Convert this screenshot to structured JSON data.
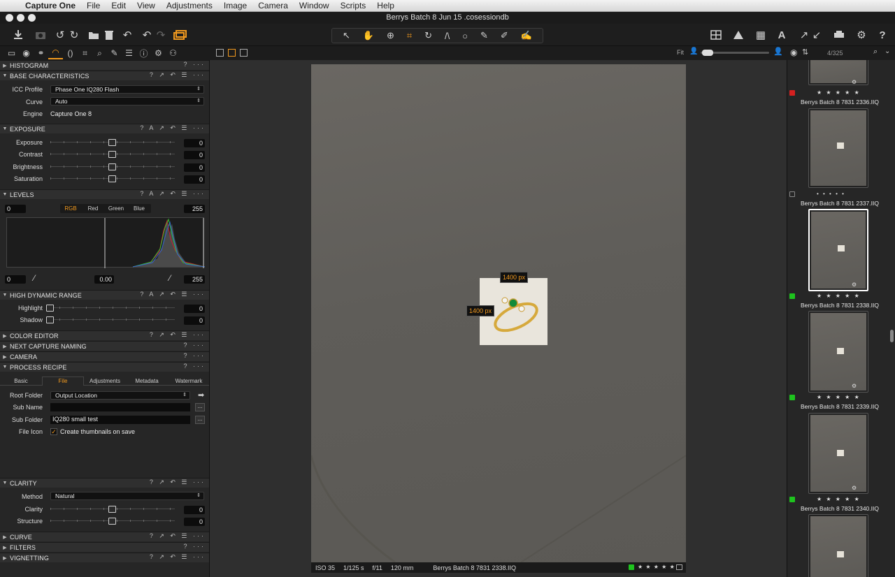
{
  "menubar": {
    "app_name": "Capture One",
    "items": [
      "File",
      "Edit",
      "View",
      "Adjustments",
      "Image",
      "Camera",
      "Window",
      "Scripts",
      "Help"
    ]
  },
  "window": {
    "title": "Berrys Batch 8 Jun 15 .cosessiondb"
  },
  "viewer": {
    "zoom_label": "Fit",
    "dimension_width": "1400 px",
    "dimension_height": "1400 px",
    "status": {
      "iso": "ISO 35",
      "shutter": "1/125 s",
      "aperture": "f/11",
      "focal": "120 mm",
      "filename": "Berrys Batch 8 7831 2338.IIQ",
      "stars": "★ ★ ★ ★ ★",
      "color_tag": "#1ec31e"
    }
  },
  "browser": {
    "counter": "4/325",
    "thumbs": [
      {
        "name": "Berrys Batch 8 7831 2336.IIQ",
        "stars": "★ ★ ★ ★ ★",
        "tag": "#d42020"
      },
      {
        "name": "Berrys Batch 8 7831 2337.IIQ",
        "stars": "• • • • •",
        "tag": "none"
      },
      {
        "name": "Berrys Batch 8 7831 2338.IIQ",
        "stars": "★ ★ ★ ★ ★",
        "tag": "#1ec31e"
      },
      {
        "name": "Berrys Batch 8 7831 2339.IIQ",
        "stars": "★ ★ ★ ★ ★",
        "tag": "#1ec31e"
      },
      {
        "name": "Berrys Batch 8 7831 2340.IIQ",
        "stars": "★ ★ ★ ★ ★",
        "tag": "#1ec31e"
      }
    ]
  },
  "tools": {
    "histogram": {
      "title": "HISTOGRAM"
    },
    "base": {
      "title": "BASE CHARACTERISTICS",
      "icc_label": "ICC Profile",
      "icc_value": "Phase One IQ280 Flash",
      "curve_label": "Curve",
      "curve_value": "Auto",
      "engine_label": "Engine",
      "engine_value": "Capture One 8"
    },
    "exposure": {
      "title": "EXPOSURE",
      "rows": [
        {
          "label": "Exposure",
          "value": "0"
        },
        {
          "label": "Contrast",
          "value": "0"
        },
        {
          "label": "Brightness",
          "value": "0"
        },
        {
          "label": "Saturation",
          "value": "0"
        }
      ]
    },
    "levels": {
      "title": "LEVELS",
      "in_low": "0",
      "in_high": "255",
      "channels": [
        "RGB",
        "Red",
        "Green",
        "Blue"
      ],
      "out_low": "0",
      "mid": "0.00",
      "out_high": "255"
    },
    "hdr": {
      "title": "HIGH DYNAMIC RANGE",
      "rows": [
        {
          "label": "Highlight",
          "value": "0"
        },
        {
          "label": "Shadow",
          "value": "0"
        }
      ]
    },
    "color_editor": {
      "title": "COLOR EDITOR"
    },
    "next_capture": {
      "title": "NEXT CAPTURE NAMING"
    },
    "camera": {
      "title": "CAMERA"
    },
    "process_recipe": {
      "title": "PROCESS RECIPE",
      "tabs": [
        "Basic",
        "File",
        "Adjustments",
        "Metadata",
        "Watermark"
      ],
      "root_label": "Root Folder",
      "root_value": "Output Location",
      "sub_name_label": "Sub Name",
      "sub_name_value": "",
      "sub_folder_label": "Sub Folder",
      "sub_folder_value": "IQ280 small test",
      "file_icon_label": "File Icon",
      "file_icon_check": "Create thumbnails on save",
      "ellipsis": "..."
    },
    "clarity": {
      "title": "CLARITY",
      "method_label": "Method",
      "method_value": "Natural",
      "rows": [
        {
          "label": "Clarity",
          "value": "0"
        },
        {
          "label": "Structure",
          "value": "0"
        }
      ]
    },
    "curve": {
      "title": "CURVE"
    },
    "filters": {
      "title": "FILTERS"
    },
    "vignetting": {
      "title": "VIGNETTING"
    }
  },
  "colors": {
    "accent": "#f39a1e",
    "chrome": "#1e1e1e",
    "panel": "#262626"
  }
}
